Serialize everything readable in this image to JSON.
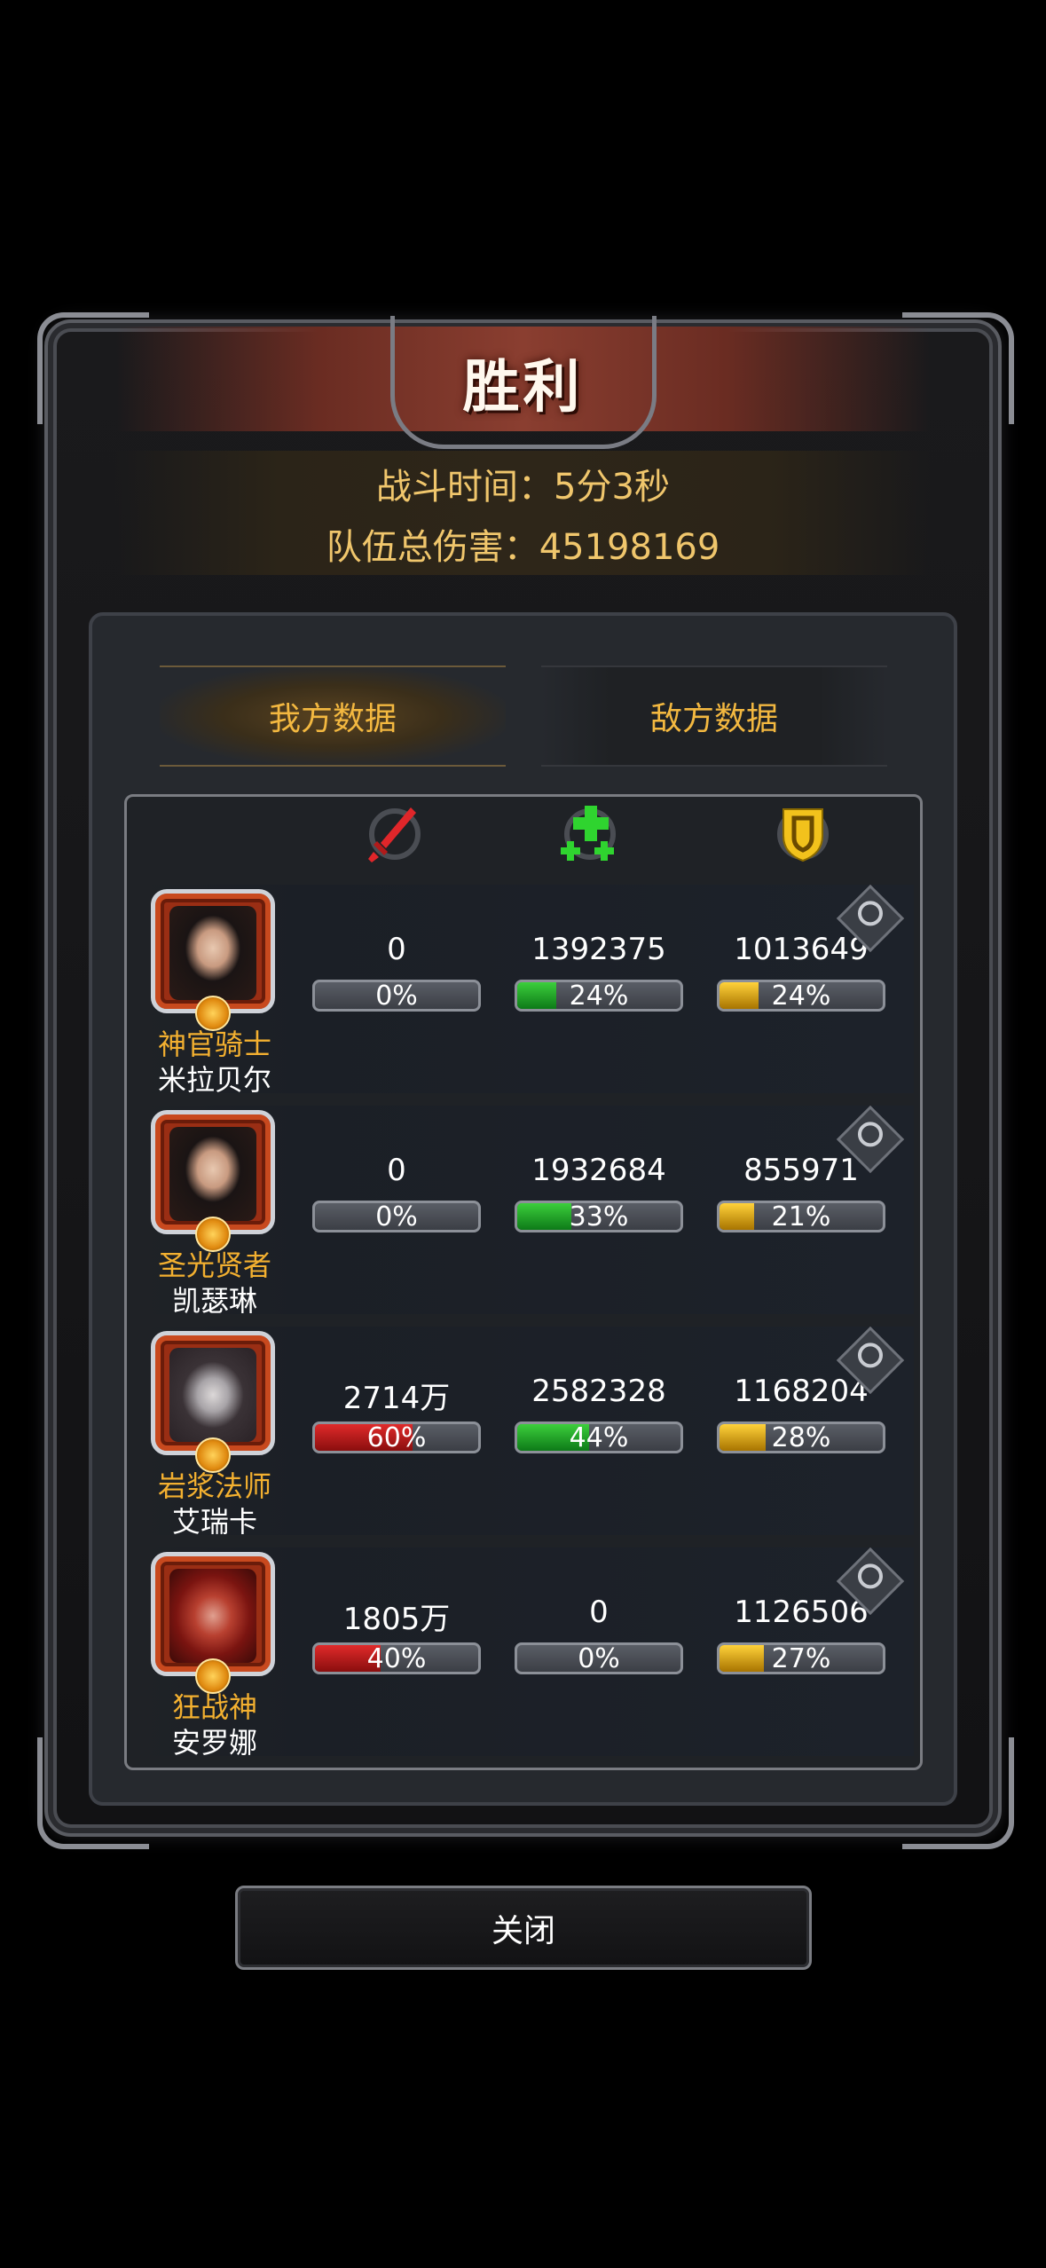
{
  "title": "胜利",
  "battle_time": "战斗时间：5分3秒",
  "team_damage": "队伍总伤害：45198169",
  "tabs": [
    {
      "label": "我方数据",
      "active": true
    },
    {
      "label": "敌方数据",
      "active": false
    }
  ],
  "header_icons": [
    "sword-icon",
    "heal-cross-icon",
    "shield-icon"
  ],
  "colors": {
    "damage": "#d42020",
    "heal": "#20b030",
    "tank": "#e0a800",
    "accent_gold": "#f3b840"
  },
  "heroes": [
    {
      "rank": "神官骑士",
      "name": "米拉贝尔",
      "damage": "0",
      "damage_pct": "0%",
      "damage_fill": 0,
      "heal": "1392375",
      "heal_pct": "24%",
      "heal_fill": 0.24,
      "tank": "1013649",
      "tank_pct": "24%",
      "tank_fill": 0.24
    },
    {
      "rank": "圣光贤者",
      "name": "凯瑟琳",
      "damage": "0",
      "damage_pct": "0%",
      "damage_fill": 0,
      "heal": "1932684",
      "heal_pct": "33%",
      "heal_fill": 0.33,
      "tank": "855971",
      "tank_pct": "21%",
      "tank_fill": 0.21
    },
    {
      "rank": "岩浆法师",
      "name": "艾瑞卡",
      "damage": "2714万",
      "damage_pct": "60%",
      "damage_fill": 0.6,
      "heal": "2582328",
      "heal_pct": "44%",
      "heal_fill": 0.44,
      "tank": "1168204",
      "tank_pct": "28%",
      "tank_fill": 0.28
    },
    {
      "rank": "狂战神",
      "name": "安罗娜",
      "damage": "1805万",
      "damage_pct": "40%",
      "damage_fill": 0.4,
      "heal": "0",
      "heal_pct": "0%",
      "heal_fill": 0,
      "tank": "1126506",
      "tank_pct": "27%",
      "tank_fill": 0.27
    }
  ],
  "close_label": "关闭"
}
